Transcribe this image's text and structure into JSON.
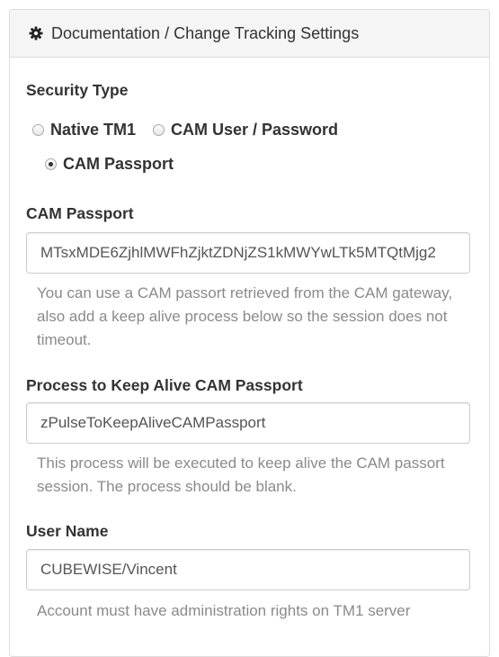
{
  "panel": {
    "title": "Documentation / Change Tracking Settings",
    "icon": "gear-icon"
  },
  "security_type": {
    "label": "Security Type",
    "options": [
      {
        "label": "Native TM1",
        "checked": false
      },
      {
        "label": "CAM User / Password",
        "checked": false
      },
      {
        "label": "CAM Passport",
        "checked": true
      }
    ]
  },
  "cam_passport": {
    "label": "CAM Passport",
    "value": "MTsxMDE6ZjhlMWFhZjktZDNjZS1kMWYwLTk5MTQtMjg2",
    "help": "You can use a CAM passort retrieved from the CAM gateway, also add a keep alive process below so the session does not timeout."
  },
  "keep_alive": {
    "label": "Process to Keep Alive CAM Passport",
    "value": "zPulseToKeepAliveCAMPassport",
    "help": "This process will be executed to keep alive the CAM passort session. The process should be blank."
  },
  "user_name": {
    "label": "User Name",
    "value": "CUBEWISE/Vincent",
    "help": "Account must have administration rights on TM1 server"
  }
}
